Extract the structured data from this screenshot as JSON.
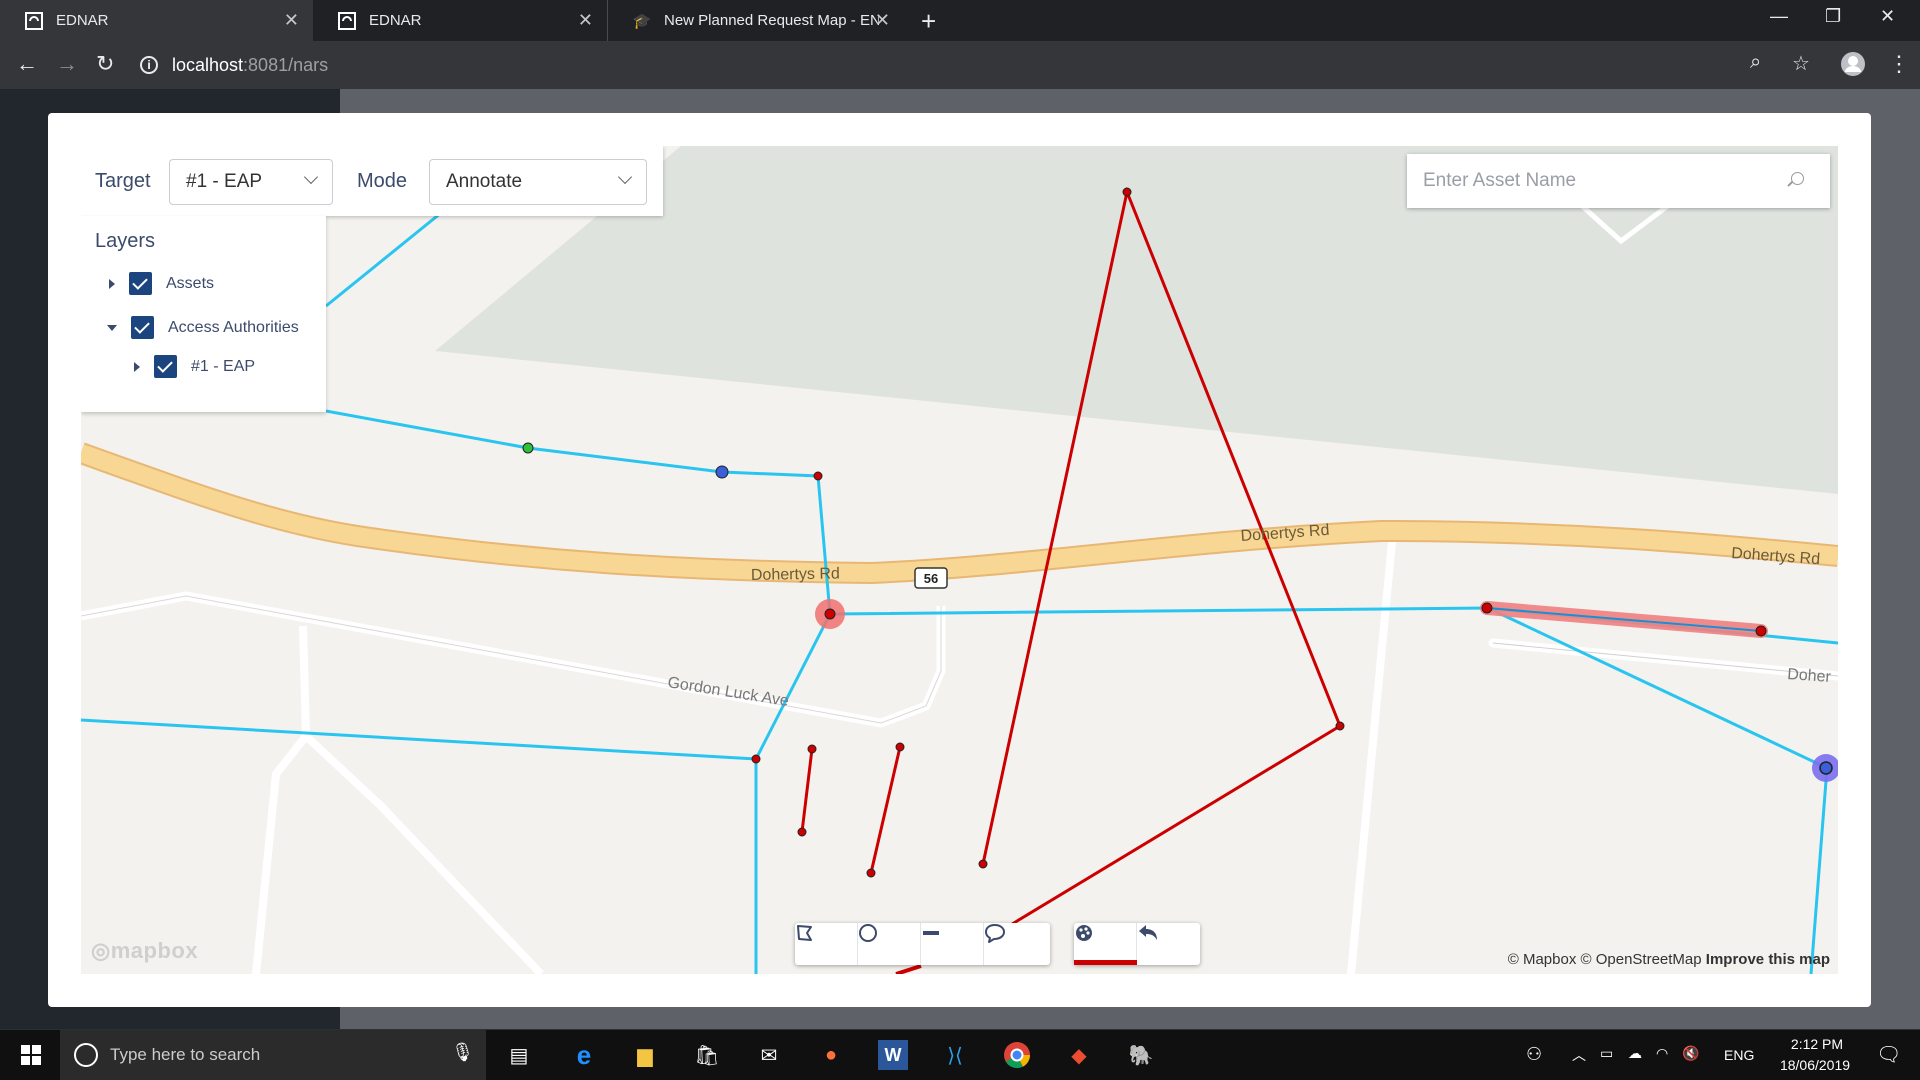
{
  "browser": {
    "tabs": [
      {
        "title": "EDNAR",
        "active": true
      },
      {
        "title": "EDNAR",
        "active": false
      },
      {
        "title": "New Planned Request Map - ENI",
        "active": false
      }
    ],
    "url_host": "localhost",
    "url_path": ":8081/nars"
  },
  "controls": {
    "target_label": "Target",
    "target_value": "#1 - EAP",
    "mode_label": "Mode",
    "mode_value": "Annotate"
  },
  "layers": {
    "title": "Layers",
    "items": [
      {
        "label": "Assets",
        "checked": true,
        "expanded": false
      },
      {
        "label": "Access Authorities",
        "checked": true,
        "expanded": true
      },
      {
        "label": "#1 - EAP",
        "checked": true,
        "expanded": false
      }
    ]
  },
  "search": {
    "placeholder": "Enter Asset Name"
  },
  "map_labels": {
    "road1": "Dohertys Rd",
    "road2": "Dohertys Rd",
    "road3": "Dohertys Rd",
    "road4": "Doher",
    "street": "Gordon Luck Ave",
    "shield": "56"
  },
  "attribution": {
    "mapbox": "© Mapbox",
    "osm": "© OpenStreetMap",
    "improve": "Improve this map",
    "logo": "mapbox"
  },
  "toolbar": {
    "tools": [
      "polygon-icon",
      "circle-icon",
      "line-icon",
      "comment-icon",
      "palette-icon",
      "undo-icon"
    ],
    "active_tool": "palette-icon",
    "accent": "#cc0000"
  },
  "taskbar": {
    "search_placeholder": "Type here to search",
    "lang": "ENG",
    "time": "2:12 PM",
    "date": "18/06/2019"
  },
  "colors": {
    "asset_line": "#29c5f0",
    "annotation_line": "#cc0000",
    "road_major": "#f7d793"
  }
}
